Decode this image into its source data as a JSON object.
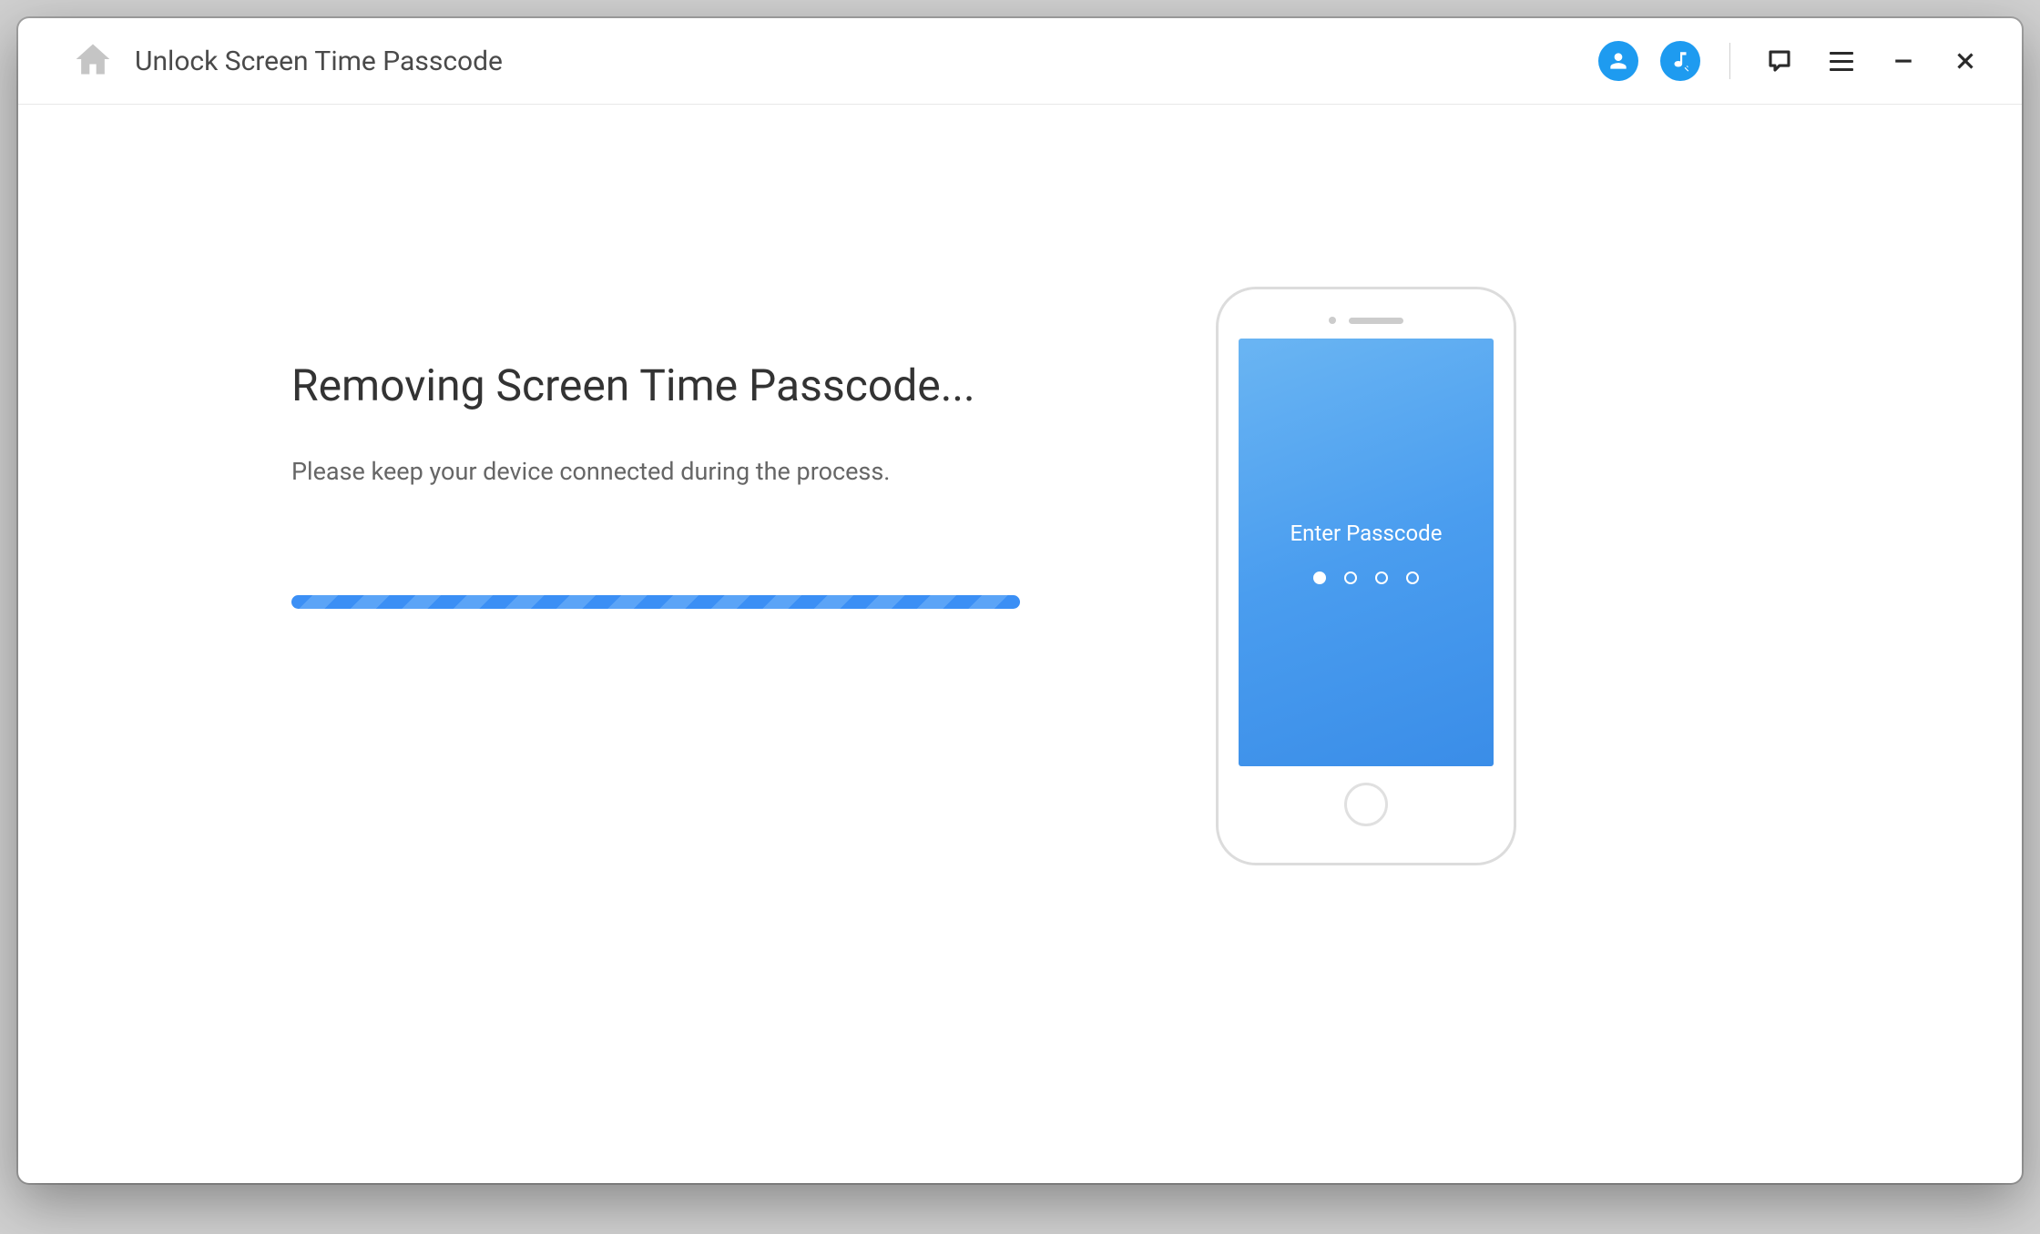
{
  "titleBar": {
    "title": "Unlock Screen Time Passcode"
  },
  "main": {
    "heading": "Removing Screen Time Passcode...",
    "subtext": "Please keep your device connected during the process."
  },
  "phone": {
    "passcodeLabel": "Enter Passcode"
  }
}
